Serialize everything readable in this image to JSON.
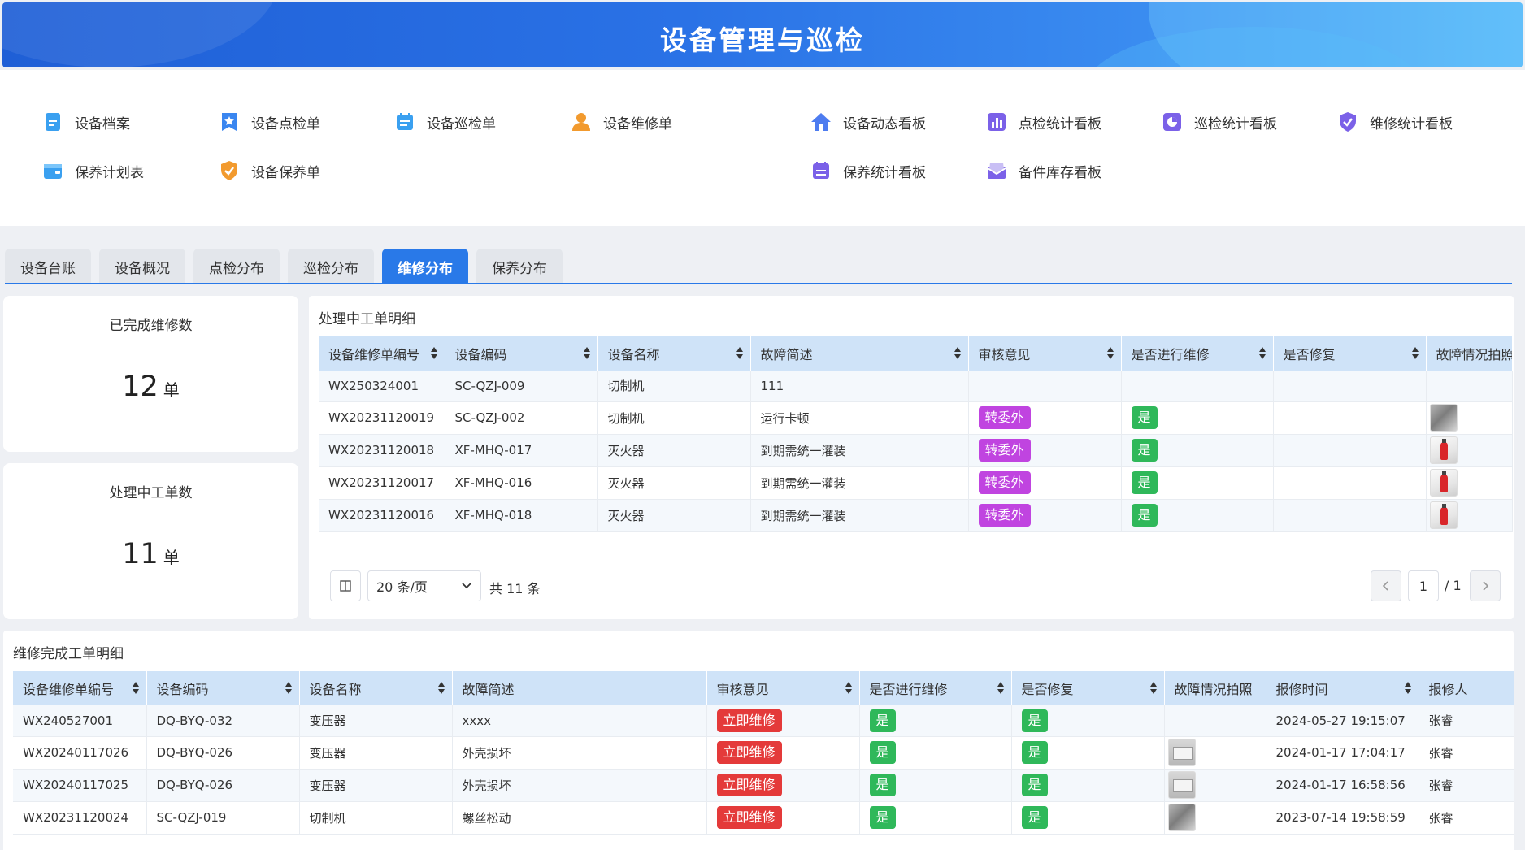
{
  "header": {
    "title": "设备管理与巡检"
  },
  "quick_menu": [
    {
      "label": "设备档案",
      "icon": "file-icon",
      "color": "#3aa0f0"
    },
    {
      "label": "设备点检单",
      "icon": "star-badge-icon",
      "color": "#3a86f0"
    },
    {
      "label": "设备巡检单",
      "icon": "calendar-list-icon",
      "color": "#3aa0f0"
    },
    {
      "label": "设备维修单",
      "icon": "user-icon",
      "color": "#f29a2e"
    },
    {
      "label": "设备动态看板",
      "icon": "home-icon",
      "color": "#4d7cf0"
    },
    {
      "label": "点检统计看板",
      "icon": "bar-chart-icon",
      "color": "#7b61e8"
    },
    {
      "label": "巡检统计看板",
      "icon": "pie-chart-icon",
      "color": "#7b61e8"
    },
    {
      "label": "维修统计看板",
      "icon": "shield-check-icon",
      "color": "#7b61e8"
    },
    {
      "label": "保养计划表",
      "icon": "wallet-icon",
      "color": "#3aa0f0"
    },
    {
      "label": "设备保养单",
      "icon": "shield-check-icon",
      "color": "#f29a2e"
    },
    {
      "label": "保养统计看板",
      "icon": "calendar-icon",
      "color": "#7b61e8"
    },
    {
      "label": "备件库存看板",
      "icon": "mail-box-icon",
      "color": "#7b61e8"
    }
  ],
  "tabs": [
    {
      "label": "设备台账",
      "active": false
    },
    {
      "label": "设备概况",
      "active": false
    },
    {
      "label": "点检分布",
      "active": false
    },
    {
      "label": "巡检分布",
      "active": false
    },
    {
      "label": "维修分布",
      "active": true
    },
    {
      "label": "保养分布",
      "active": false
    }
  ],
  "stats": {
    "completed": {
      "title": "已完成维修数",
      "value": "12",
      "unit": "单"
    },
    "processing": {
      "title": "处理中工单数",
      "value": "11",
      "unit": "单"
    }
  },
  "processing_table": {
    "title": "处理中工单明细",
    "columns": [
      "设备维修单编号",
      "设备编码",
      "设备名称",
      "故障简述",
      "审核意见",
      "是否进行维修",
      "是否修复",
      "故障情况拍照"
    ],
    "rows": [
      {
        "no": "WX250324001",
        "code": "SC-QZJ-009",
        "name": "切制机",
        "desc": "111",
        "review": "",
        "repair": "",
        "fixed": "",
        "photo": ""
      },
      {
        "no": "WX20231120019",
        "code": "SC-QZJ-002",
        "name": "切制机",
        "desc": "运行卡顿",
        "review": "转委外",
        "repair": "是",
        "fixed": "",
        "photo": "mach"
      },
      {
        "no": "WX20231120018",
        "code": "XF-MHQ-017",
        "name": "灭火器",
        "desc": "到期需统一灌装",
        "review": "转委外",
        "repair": "是",
        "fixed": "",
        "photo": "ext"
      },
      {
        "no": "WX20231120017",
        "code": "XF-MHQ-016",
        "name": "灭火器",
        "desc": "到期需统一灌装",
        "review": "转委外",
        "repair": "是",
        "fixed": "",
        "photo": "ext"
      },
      {
        "no": "WX20231120016",
        "code": "XF-MHQ-018",
        "name": "灭火器",
        "desc": "到期需统一灌装",
        "review": "转委外",
        "repair": "是",
        "fixed": "",
        "photo": "ext"
      }
    ],
    "pagination": {
      "page_size": "20 条/页",
      "total": "共 11 条",
      "current": "1",
      "pages": "/ 1"
    }
  },
  "completed_table": {
    "title": "维修完成工单明细",
    "columns": [
      "设备维修单编号",
      "设备编码",
      "设备名称",
      "故障简述",
      "审核意见",
      "是否进行维修",
      "是否修复",
      "故障情况拍照",
      "报修时间",
      "报修人"
    ],
    "rows": [
      {
        "no": "WX240527001",
        "code": "DQ-BYQ-032",
        "name": "变压器",
        "desc": "xxxx",
        "review": "立即维修",
        "repair": "是",
        "fixed": "是",
        "photo": "",
        "time": "2024-05-27 19:15:07",
        "person": "张睿"
      },
      {
        "no": "WX20240117026",
        "code": "DQ-BYQ-026",
        "name": "变压器",
        "desc": "外壳损坏",
        "review": "立即维修",
        "repair": "是",
        "fixed": "是",
        "photo": "box",
        "time": "2024-01-17 17:04:17",
        "person": "张睿"
      },
      {
        "no": "WX20240117025",
        "code": "DQ-BYQ-026",
        "name": "变压器",
        "desc": "外壳损坏",
        "review": "立即维修",
        "repair": "是",
        "fixed": "是",
        "photo": "box",
        "time": "2024-01-17 16:58:56",
        "person": "张睿"
      },
      {
        "no": "WX20231120024",
        "code": "SC-QZJ-019",
        "name": "切制机",
        "desc": "螺丝松动",
        "review": "立即维修",
        "repair": "是",
        "fixed": "是",
        "photo": "mach",
        "time": "2023-07-14 19:58:59",
        "person": "张睿"
      }
    ]
  }
}
